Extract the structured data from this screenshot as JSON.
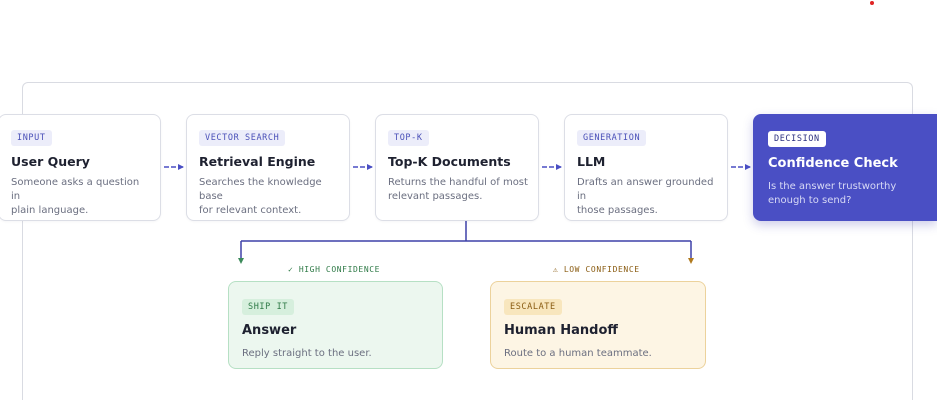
{
  "pipeline": [
    {
      "tag": "INPUT",
      "title": "User Query",
      "desc_lines": [
        "Someone asks a question in",
        "plain language."
      ]
    },
    {
      "tag": "VECTOR SEARCH",
      "title": "Retrieval Engine",
      "desc_lines": [
        "Searches the knowledge base",
        "for relevant context."
      ]
    },
    {
      "tag": "TOP-K",
      "title": "Top-K Documents",
      "desc_lines": [
        "Returns the handful of most",
        "relevant passages."
      ]
    },
    {
      "tag": "GENERATION",
      "title": "LLM",
      "desc_lines": [
        "Drafts an answer grounded in",
        "those passages."
      ]
    },
    {
      "tag": "DECISION",
      "title": "Confidence Check",
      "desc_lines": [
        "Is the answer trustworthy",
        "enough to send?"
      ]
    }
  ],
  "branches": {
    "high": {
      "label": "✓ HIGH CONFIDENCE",
      "tag": "SHIP IT",
      "title": "Answer",
      "desc": "Reply straight to the user."
    },
    "low": {
      "label": "⚠ LOW CONFIDENCE",
      "tag": "ESCALATE",
      "title": "Human Handoff",
      "desc": "Route to a human teammate."
    }
  },
  "colors": {
    "connector": "#4a4fc4",
    "decision_fill": "#4a4fc4",
    "high_arrow": "#3c8a5a",
    "low_arrow": "#b07a1e"
  }
}
